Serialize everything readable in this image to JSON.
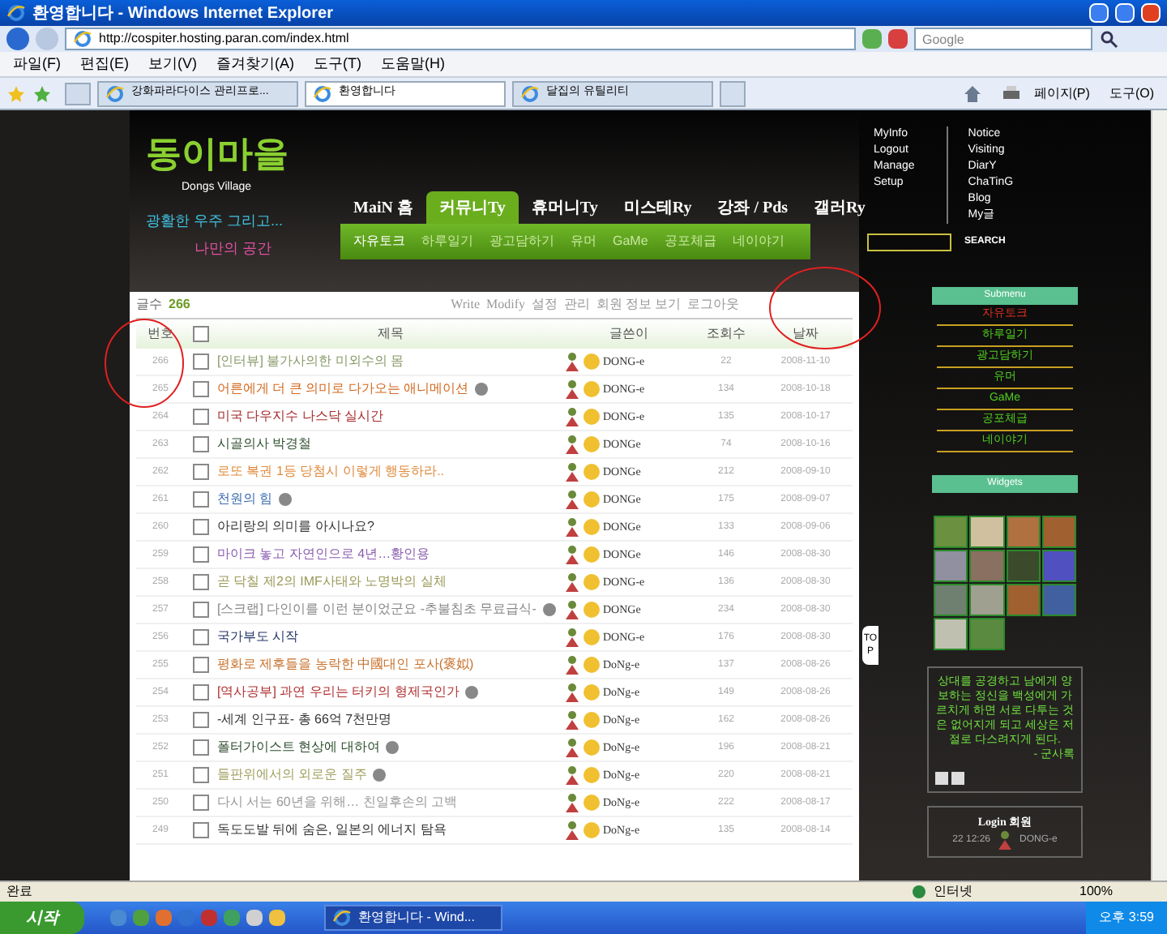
{
  "window": {
    "title": "환영합니다 - Windows Internet Explorer"
  },
  "address_bar": {
    "url": "http://cospiter.hosting.paran.com/index.html"
  },
  "search": {
    "placeholder": "Google"
  },
  "menu": [
    "파일(F)",
    "편집(E)",
    "보기(V)",
    "즐겨찾기(A)",
    "도구(T)",
    "도움말(H)"
  ],
  "browser_tabs": [
    {
      "label": "강화파라다이스 관리프로...",
      "selected": false
    },
    {
      "label": "환영합니다",
      "selected": true
    },
    {
      "label": "달집의 유틸리티",
      "selected": false
    }
  ],
  "command_bar": [
    "페이지(P)",
    "도구(O)"
  ],
  "site": {
    "logo": "동이마을",
    "logo_subtitle": "Dongs Village",
    "slogan_1": "광활한 우주 그리고...",
    "slogan_2": "나만의 공간",
    "nav": [
      {
        "label": "MaiN 홈",
        "selected": false
      },
      {
        "label": "커뮤니Ty",
        "selected": true
      },
      {
        "label": "휴머니Ty",
        "selected": false
      },
      {
        "label": "미스테Ry",
        "selected": false
      },
      {
        "label": "강좌 / Pds",
        "selected": false
      },
      {
        "label": "갤러Ry",
        "selected": false
      }
    ],
    "subnav": [
      {
        "label": "자유토크",
        "selected": true
      },
      {
        "label": "하루일기",
        "selected": false
      },
      {
        "label": "광고담하기",
        "selected": false
      },
      {
        "label": "유머",
        "selected": false
      },
      {
        "label": "GaMe",
        "selected": false
      },
      {
        "label": "공포체급",
        "selected": false
      },
      {
        "label": "네이야기",
        "selected": false
      }
    ],
    "top_links_1": [
      "MyInfo",
      "Logout",
      "Manage",
      "Setup"
    ],
    "top_links_2": [
      "Notice",
      "Visiting",
      "DiarY",
      "ChaTinG",
      "Blog",
      "My글"
    ],
    "search_button": "SEARCH"
  },
  "board": {
    "count_label": "글수",
    "count": "266",
    "toolbar": [
      "Write",
      "Modify",
      "설정",
      "관리",
      "회원 정보 보기",
      "로그아웃"
    ],
    "columns": [
      "번호",
      "제목",
      "글쓴이",
      "조회수",
      "날짜"
    ],
    "select_all_checked": false,
    "rows": [
      {
        "no": "266",
        "title": "[인터뷰] 불가사의한 미외수의 몸",
        "color": "#8a9a6a",
        "author": "DONG-e",
        "views": "22",
        "date": "2008-11-10",
        "checked": false,
        "image_icon": false
      },
      {
        "no": "265",
        "title": "어른에게 더 큰 의미로 다가오는 애니메이션",
        "color": "#d2691e",
        "author": "DONG-e",
        "views": "134",
        "date": "2008-10-18",
        "checked": false,
        "image_icon": true
      },
      {
        "no": "264",
        "title": "미국 다우지수 나스닥 실시간",
        "color": "#a52a2a",
        "author": "DONG-e",
        "views": "135",
        "date": "2008-10-17",
        "checked": false,
        "image_icon": false
      },
      {
        "no": "263",
        "title": "시골의사 박경철",
        "color": "#2f4f2f",
        "author": "DONGe",
        "views": "74",
        "date": "2008-10-16",
        "checked": false,
        "image_icon": false
      },
      {
        "no": "262",
        "title": "로또 복권 1등 당첨시 이렇게 행동하라..",
        "color": "#e08a3c",
        "author": "DONGe",
        "views": "212",
        "date": "2008-09-10",
        "checked": false,
        "image_icon": false
      },
      {
        "no": "261",
        "title": "천원의 힘",
        "color": "#3a6bb0",
        "author": "DONGe",
        "views": "175",
        "date": "2008-09-07",
        "checked": false,
        "image_icon": true
      },
      {
        "no": "260",
        "title": "아리랑의 의미를 아시나요?",
        "color": "#333333",
        "author": "DONGe",
        "views": "133",
        "date": "2008-09-06",
        "checked": false,
        "image_icon": false
      },
      {
        "no": "259",
        "title": "마이크 놓고 자연인으로 4년…황인용",
        "color": "#8a5cb0",
        "author": "DONGe",
        "views": "146",
        "date": "2008-08-30",
        "checked": false,
        "image_icon": false
      },
      {
        "no": "258",
        "title": "곧 닥칠 제2의 IMF사태와 노명박의 실체",
        "color": "#9a9a5a",
        "author": "DONG-e",
        "views": "136",
        "date": "2008-08-30",
        "checked": false,
        "image_icon": false
      },
      {
        "no": "257",
        "title": "[스크랩] 다인이를 이런 분이었군요 -추불침초 무료급식-",
        "color": "#888888",
        "author": "DONGe",
        "views": "234",
        "date": "2008-08-30",
        "checked": false,
        "image_icon": true
      },
      {
        "no": "256",
        "title": "국가부도 시작",
        "color": "#223366",
        "author": "DONG-e",
        "views": "176",
        "date": "2008-08-30",
        "checked": false,
        "image_icon": false
      },
      {
        "no": "255",
        "title": "평화로 제후들을 농락한 中國대인 포사(褒姒)",
        "color": "#c8702a",
        "author": "DoNg-e",
        "views": "137",
        "date": "2008-08-26",
        "checked": false,
        "image_icon": false
      },
      {
        "no": "254",
        "title": "[역사공부] 과연 우리는 터키의 형제국인가",
        "color": "#b03030",
        "author": "DoNg-e",
        "views": "149",
        "date": "2008-08-26",
        "checked": false,
        "image_icon": true
      },
      {
        "no": "253",
        "title": "-세계 인구표- 총 66억 7천만명",
        "color": "#333333",
        "author": "DoNg-e",
        "views": "162",
        "date": "2008-08-26",
        "checked": false,
        "image_icon": false
      },
      {
        "no": "252",
        "title": "폴터가이스트 현상에 대하여",
        "color": "#2a4a2a",
        "author": "DoNg-e",
        "views": "196",
        "date": "2008-08-21",
        "checked": false,
        "image_icon": true
      },
      {
        "no": "251",
        "title": "들판위에서의 외로운 질주",
        "color": "#a0a060",
        "author": "DoNg-e",
        "views": "220",
        "date": "2008-08-21",
        "checked": false,
        "image_icon": true
      },
      {
        "no": "250",
        "title": "다시 서는 60년을 위해… 친일후손의 고백",
        "color": "#999999",
        "author": "DoNg-e",
        "views": "222",
        "date": "2008-08-17",
        "checked": false,
        "image_icon": false
      },
      {
        "no": "249",
        "title": "독도도발 뒤에 숨은, 일본의 에너지 탐욕",
        "color": "#333333",
        "author": "DoNg-e",
        "views": "135",
        "date": "2008-08-14",
        "checked": false,
        "image_icon": false
      }
    ]
  },
  "sidebar": {
    "submenu_title": "Submenu",
    "submenu": [
      {
        "label": "자유토크",
        "selected": true
      },
      {
        "label": "하루일기",
        "selected": false
      },
      {
        "label": "광고담하기",
        "selected": false
      },
      {
        "label": "유머",
        "selected": false
      },
      {
        "label": "GaMe",
        "selected": false
      },
      {
        "label": "공포체급",
        "selected": false
      },
      {
        "label": "네이야기",
        "selected": false
      }
    ],
    "widgets_title": "Widgets",
    "quote": "상대를 공경하고 남에게 양보하는 정신을 백성에게 가르치게 하면 서로 다투는 것은 없어지게 되고 세상은 저절로 다스려지게 된다.",
    "quote_source": "- 군사록",
    "login_title": "Login 회원",
    "login_time": "22 12:26",
    "login_user": "DONG-e"
  },
  "top_tab": "TOP",
  "status_bar": {
    "text": "완료",
    "zone": "인터넷",
    "zoom": "100%"
  },
  "taskbar": {
    "start": "시작",
    "task": "환영합니다 - Wind...",
    "clock": "오후 3:59"
  }
}
